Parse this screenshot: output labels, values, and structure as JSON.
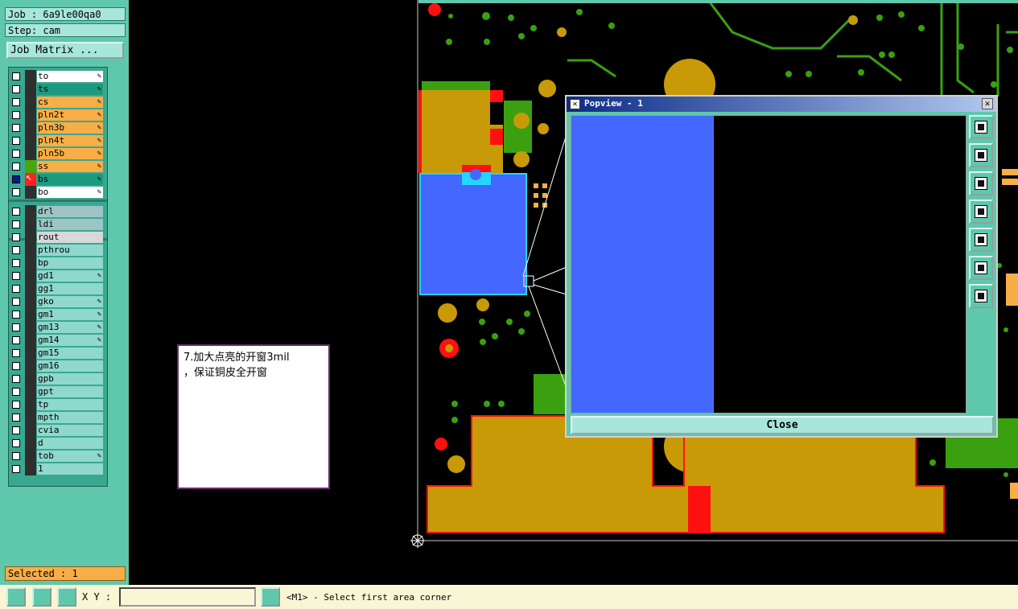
{
  "header": {
    "job": "Job : 6a9le00qa0",
    "step": "Step: cam",
    "job_matrix": "Job Matrix ..."
  },
  "layers_group1": [
    {
      "name": "to",
      "color": "#ffffff",
      "pen": true
    },
    {
      "name": "ts",
      "color": "#1c9a80",
      "pen": true
    },
    {
      "name": "cs",
      "color": "#f7ae47",
      "pen": true
    },
    {
      "name": "pln2t",
      "color": "#f7ae47",
      "pen": true
    },
    {
      "name": "pln3b",
      "color": "#f7ae47",
      "pen": true
    },
    {
      "name": "pln4t",
      "color": "#f7ae47",
      "pen": true
    },
    {
      "name": "pln5b",
      "color": "#f7ae47",
      "pen": true
    },
    {
      "name": "ss",
      "color": "#f7ae47",
      "pen": true
    },
    {
      "name": "bs",
      "color": "#1c9a80",
      "pen": true
    },
    {
      "name": "bo",
      "color": "#ffffff",
      "pen": true
    }
  ],
  "layers_group2": [
    {
      "name": "drl",
      "color": "#9ec4c6",
      "pen": false
    },
    {
      "name": "ldi",
      "color": "#9ec4c6",
      "pen": false
    },
    {
      "name": "rout",
      "color": "#d8d8d8",
      "pen": false
    }
  ],
  "layers_group3": [
    {
      "name": "pthrou",
      "color": "#8fd8ce",
      "pen": false
    },
    {
      "name": "bp",
      "color": "#8fd8ce",
      "pen": false
    },
    {
      "name": "gd1",
      "color": "#8fd8ce",
      "pen": true
    },
    {
      "name": "gg1",
      "color": "#8fd8ce",
      "pen": false
    },
    {
      "name": "gko",
      "color": "#8fd8ce",
      "pen": true
    },
    {
      "name": "gm1",
      "color": "#8fd8ce",
      "pen": true
    },
    {
      "name": "gm13",
      "color": "#8fd8ce",
      "pen": true
    },
    {
      "name": "gm14",
      "color": "#8fd8ce",
      "pen": true
    },
    {
      "name": "gm15",
      "color": "#8fd8ce",
      "pen": false
    },
    {
      "name": "gm16",
      "color": "#8fd8ce",
      "pen": false
    },
    {
      "name": "gpb",
      "color": "#8fd8ce",
      "pen": false
    },
    {
      "name": "gpt",
      "color": "#8fd8ce",
      "pen": false
    },
    {
      "name": "tp",
      "color": "#8fd8ce",
      "pen": false
    },
    {
      "name": "mpth",
      "color": "#8fd8ce",
      "pen": false
    },
    {
      "name": "cvia",
      "color": "#8fd8ce",
      "pen": false
    },
    {
      "name": "d",
      "color": "#8fd8ce",
      "pen": false
    },
    {
      "name": "tob",
      "color": "#8fd8ce",
      "pen": true
    },
    {
      "name": "1",
      "color": "#8fd8ce",
      "pen": false
    }
  ],
  "pen_glyph": "✎",
  "selected": "Selected : 1",
  "bottom": {
    "xy_label": "X Y :",
    "xy_value": "",
    "status": "<M1> - Select first area corner"
  },
  "note": "7.加大点亮的开窗3mil\n，保证铜皮全开窗",
  "popview": {
    "title": "Popview - 1",
    "close_label": "Close",
    "x_label": "✕",
    "icon_glyph": "✕"
  }
}
